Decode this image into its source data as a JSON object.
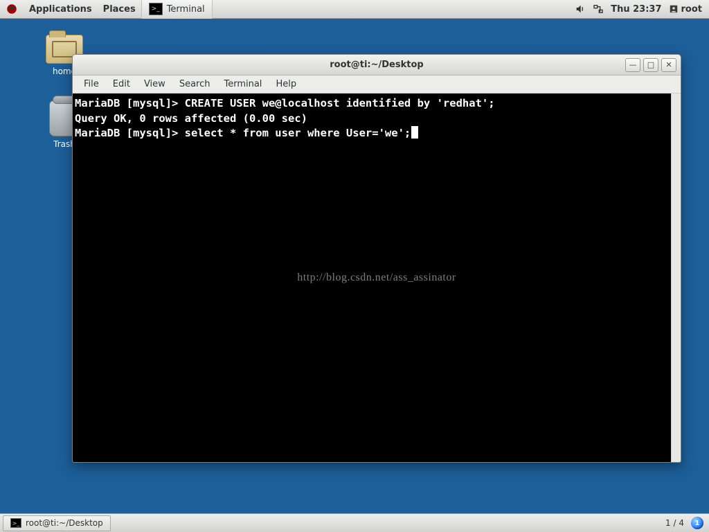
{
  "top_panel": {
    "applications": "Applications",
    "places": "Places",
    "launcher_label": "Terminal",
    "clock": "Thu 23:37",
    "user": "root"
  },
  "desktop": {
    "home_label": "home",
    "trash_label": "Trash"
  },
  "window": {
    "title": "root@ti:~/Desktop",
    "menu": {
      "file": "File",
      "edit": "Edit",
      "view": "View",
      "search": "Search",
      "terminal": "Terminal",
      "help": "Help"
    },
    "term": {
      "line1": "MariaDB [mysql]> CREATE USER we@localhost identified by 'redhat';",
      "line2": "Query OK, 0 rows affected (0.00 sec)",
      "line3": "",
      "line4": "MariaDB [mysql]> select * from user where User='we';"
    },
    "watermark": "http://blog.csdn.net/ass_assinator"
  },
  "bottom_panel": {
    "task_label": "root@ti:~/Desktop",
    "pager": "1 / 4",
    "ws": "1"
  }
}
